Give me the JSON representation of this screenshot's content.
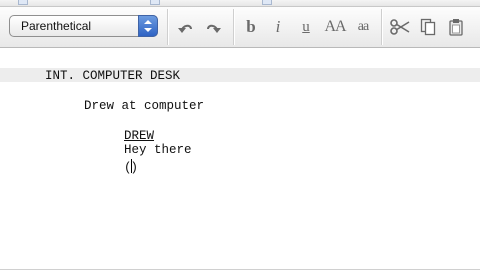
{
  "toolbar": {
    "element_type": {
      "selected": "Parenthetical"
    },
    "undo_icon": "undo-icon",
    "redo_icon": "redo-icon",
    "bold_label": "b",
    "italic_label": "i",
    "underline_label": "u",
    "uppercase_label": "AA",
    "lowercase_label": "aa",
    "cut_icon": "scissors-icon",
    "copy_icon": "copy-icon",
    "paste_icon": "clipboard-icon"
  },
  "script": {
    "scene_heading": "INT. COMPUTER DESK",
    "action": "Drew at computer",
    "character": "DREW",
    "dialogue": "Hey there",
    "parenthetical_open": "(",
    "parenthetical_close": ")"
  },
  "colors": {
    "stepper_blue": "#2e63c4",
    "scene_highlight": "#ededed"
  }
}
